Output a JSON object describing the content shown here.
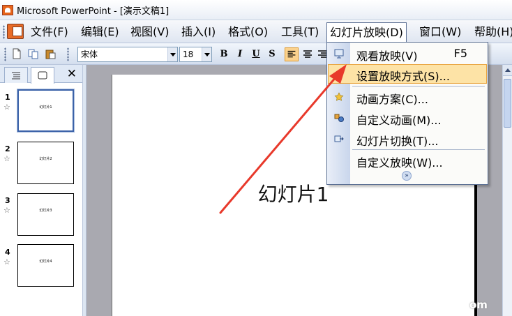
{
  "titlebar": {
    "title": "Microsoft PowerPoint - [演示文稿1]"
  },
  "menubar": {
    "items": [
      {
        "label": "文件(F)"
      },
      {
        "label": "编辑(E)"
      },
      {
        "label": "视图(V)"
      },
      {
        "label": "插入(I)"
      },
      {
        "label": "格式(O)"
      },
      {
        "label": "工具(T)"
      },
      {
        "label": "幻灯片放映(D)",
        "active": true
      },
      {
        "label": "窗口(W)"
      },
      {
        "label": "帮助(H)"
      }
    ]
  },
  "toolbar": {
    "font_name": "宋体",
    "font_size": "18",
    "bold": "B",
    "italic": "I",
    "underline": "U",
    "shadow": "S"
  },
  "left_pane": {
    "slides": [
      {
        "number": "1",
        "star": "☆",
        "title": "幻灯片1",
        "selected": true
      },
      {
        "number": "2",
        "star": "☆",
        "title": "幻灯片2"
      },
      {
        "number": "3",
        "star": "☆",
        "title": "幻灯片3"
      },
      {
        "number": "4",
        "star": "☆",
        "title": "幻灯片4"
      }
    ]
  },
  "slide": {
    "title": "幻灯片1"
  },
  "dropdown": {
    "items": [
      {
        "label": "观看放映(V)",
        "shortcut": "F5",
        "icon": "view-show-icon"
      },
      {
        "label": "设置放映方式(S)...",
        "highlighted": true
      },
      {
        "label": "动画方案(C)...",
        "icon": "animation-scheme-icon"
      },
      {
        "label": "自定义动画(M)...",
        "icon": "custom-animation-icon"
      },
      {
        "label": "幻灯片切换(T)...",
        "icon": "slide-transition-icon"
      },
      {
        "label": "自定义放映(W)..."
      }
    ],
    "expand_glyph": "»"
  },
  "annotation": {
    "color": "#e8392b"
  },
  "watermark": {
    "text": "om"
  }
}
